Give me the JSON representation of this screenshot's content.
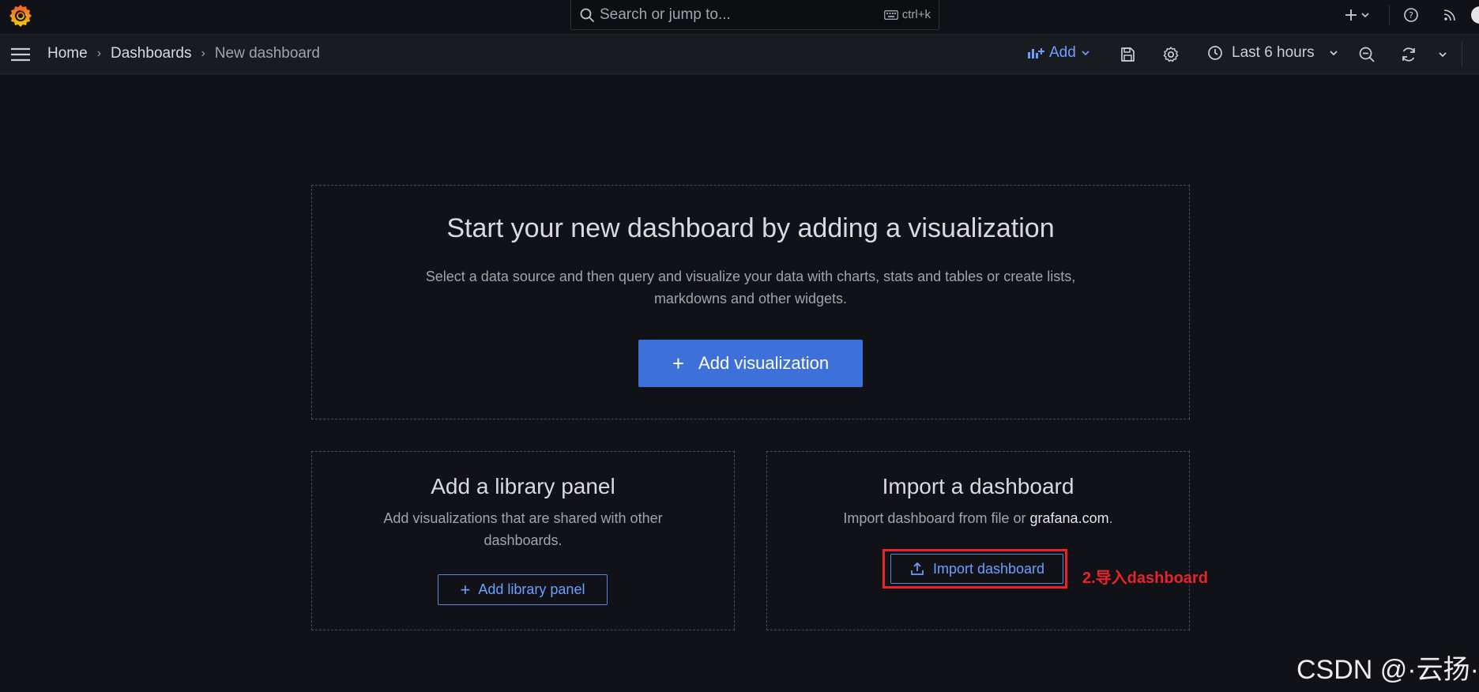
{
  "topbar": {
    "logo": "grafana-logo",
    "search": {
      "placeholder": "Search or jump to...",
      "shortcut": "ctrl+k"
    },
    "icons": [
      "plus-icon",
      "chevron-down-icon",
      "help-icon",
      "rss-icon",
      "avatar"
    ]
  },
  "navbar": {
    "breadcrumbs": [
      "Home",
      "Dashboards",
      "New dashboard"
    ],
    "add_label": "Add",
    "time_range": "Last 6 hours",
    "icons": [
      "save-icon",
      "gear-icon",
      "clock-icon",
      "zoom-out-icon",
      "refresh-icon",
      "chevron-down-icon"
    ]
  },
  "main": {
    "title": "Start your new dashboard by adding a visualization",
    "description": "Select a data source and then query and visualize your data with charts, stats and tables or create lists, markdowns and other widgets.",
    "add_visualization": "Add visualization",
    "library": {
      "title": "Add a library panel",
      "description": "Add visualizations that are shared with other dashboards.",
      "button": "Add library panel"
    },
    "import": {
      "title": "Import a dashboard",
      "description_prefix": "Import dashboard from file or ",
      "description_link": "grafana.com",
      "description_suffix": ".",
      "button": "Import dashboard"
    }
  },
  "annotation": {
    "text": "2.导入dashboard",
    "color": "#e8242b"
  },
  "watermark": "CSDN @·云扬·",
  "colors": {
    "background": "#111217",
    "primary": "#3d71d9",
    "link": "#6e9fff",
    "annotation": "#e8242b"
  }
}
